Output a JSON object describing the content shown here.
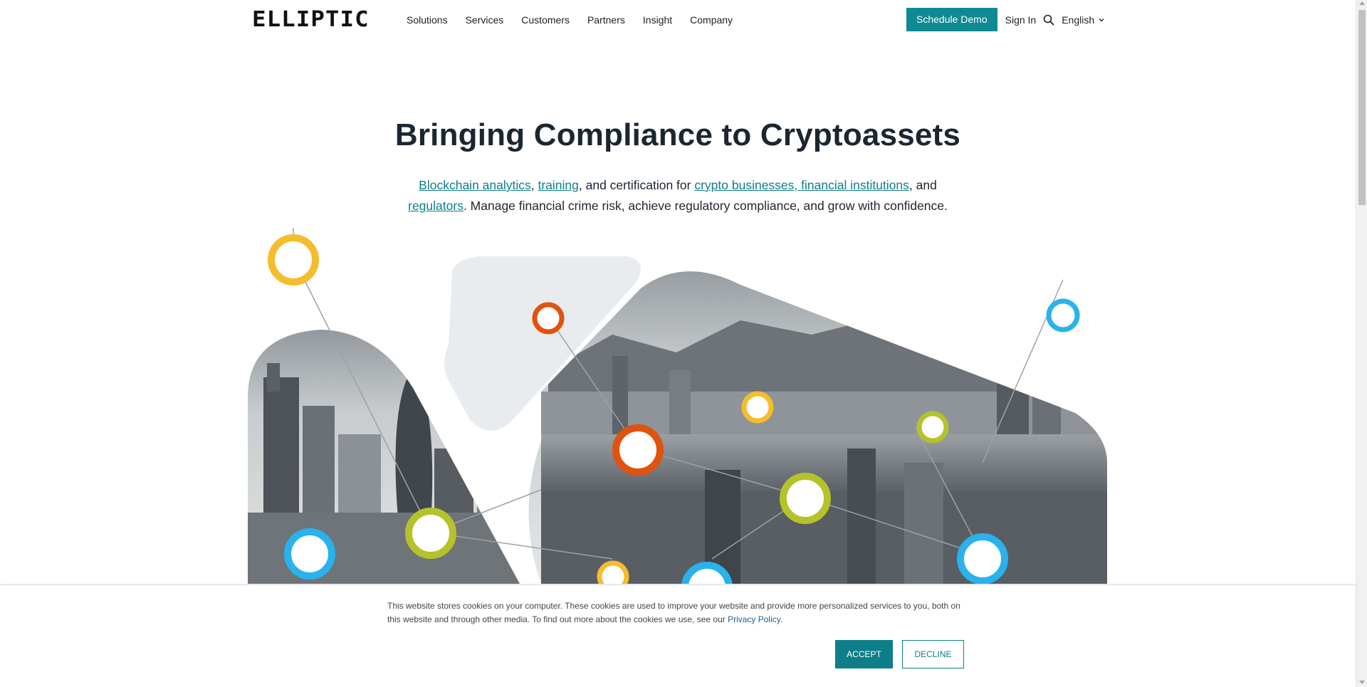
{
  "header": {
    "logo_text": "ELLIPTIC",
    "nav": [
      "Solutions",
      "Services",
      "Customers",
      "Partners",
      "Insight",
      "Company"
    ],
    "schedule_demo": "Schedule Demo",
    "sign_in": "Sign In",
    "language": "English"
  },
  "hero": {
    "title": "Bringing Compliance to Cryptoassets",
    "link_analytics": "Blockchain analytics",
    "sep1": ", ",
    "link_training": "training",
    "text_cert": ", and certification for ",
    "link_crypto": "crypto businesses, financial institutions",
    "text_and": ", and",
    "link_regulators": "regulators",
    "text_rest": ".  Manage financial crime risk, achieve regulatory compliance, and grow with confidence."
  },
  "cookie": {
    "text": "This website stores cookies on your computer. These cookies are used to improve your website and provide more personalized services to you, both on this website and through other media. To find out more about the cookies we use, see our ",
    "privacy_link": "Privacy Policy",
    "after_link": ".",
    "accept": "ACCEPT",
    "decline": "DECLINE"
  },
  "colors": {
    "accent": "#0e8a92",
    "link": "#0e7f88",
    "ring_yellow": "#f5bc2c",
    "ring_orange": "#e0530f",
    "ring_lime": "#b6c22a",
    "ring_blue": "#2ab2ec"
  }
}
